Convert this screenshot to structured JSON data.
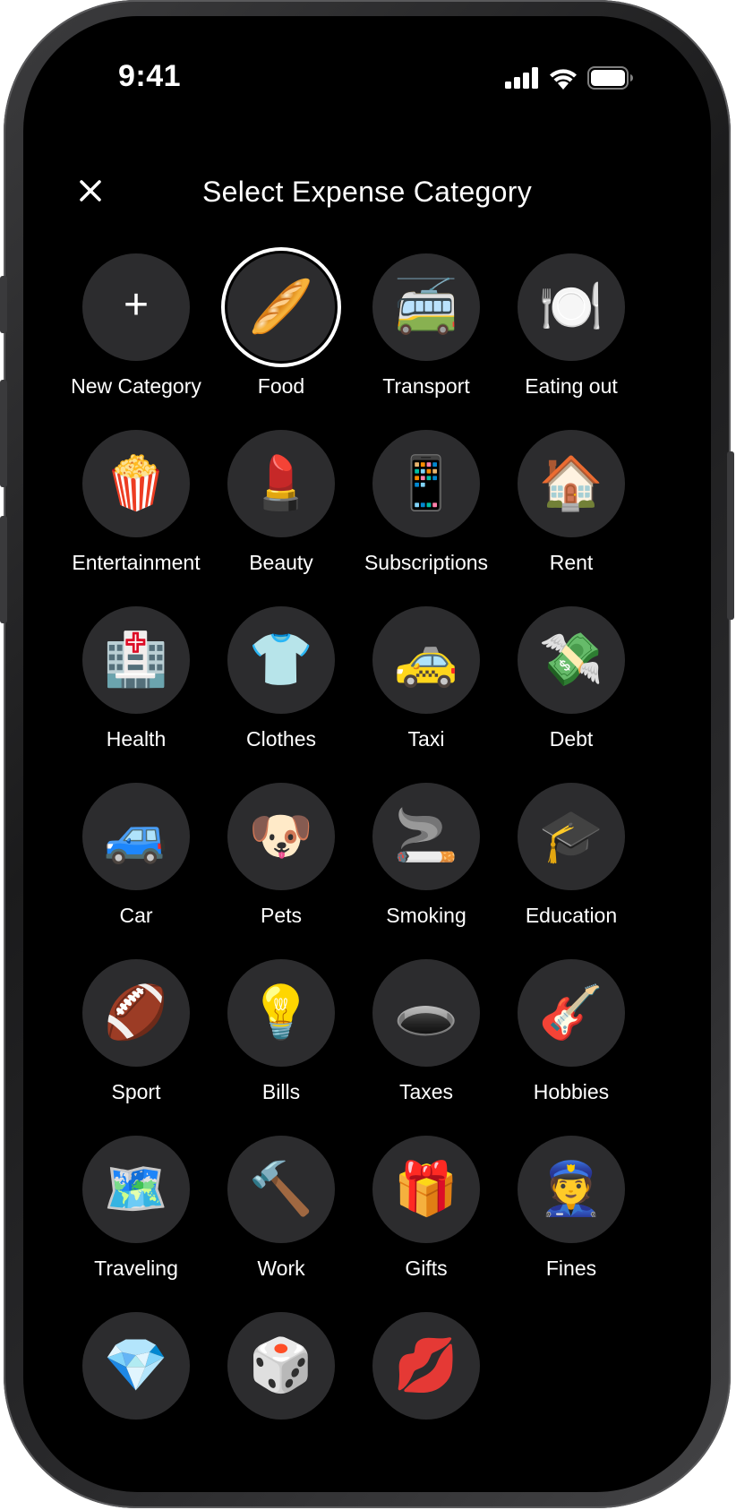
{
  "status_bar": {
    "time": "9:41"
  },
  "header": {
    "title": "Select Expense Category",
    "close_icon": "close-icon"
  },
  "categories": [
    {
      "label": "New Category",
      "icon": "+",
      "icon_name": "plus-icon"
    },
    {
      "label": "Food",
      "icon": "🥖",
      "icon_name": "baguette-icon",
      "selected": true
    },
    {
      "label": "Transport",
      "icon": "🚎",
      "icon_name": "trolleybus-icon"
    },
    {
      "label": "Eating out",
      "icon": "🍽️",
      "icon_name": "plate-cutlery-icon"
    },
    {
      "label": "Entertainment",
      "icon": "🍿",
      "icon_name": "popcorn-icon"
    },
    {
      "label": "Beauty",
      "icon": "💄",
      "icon_name": "lipstick-icon"
    },
    {
      "label": "Subscriptions",
      "icon": "📱",
      "icon_name": "phone-icon"
    },
    {
      "label": "Rent",
      "icon": "🏠",
      "icon_name": "house-icon"
    },
    {
      "label": "Health",
      "icon": "🏥",
      "icon_name": "hospital-icon"
    },
    {
      "label": "Clothes",
      "icon": "👕",
      "icon_name": "shirt-icon"
    },
    {
      "label": "Taxi",
      "icon": "🚕",
      "icon_name": "taxi-icon"
    },
    {
      "label": "Debt",
      "icon": "💸",
      "icon_name": "money-wings-icon"
    },
    {
      "label": "Car",
      "icon": "🚙",
      "icon_name": "car-icon"
    },
    {
      "label": "Pets",
      "icon": "🐶",
      "icon_name": "dog-icon"
    },
    {
      "label": "Smoking",
      "icon": "🚬",
      "icon_name": "cigarette-icon"
    },
    {
      "label": "Education",
      "icon": "🎓",
      "icon_name": "graduation-cap-icon"
    },
    {
      "label": "Sport",
      "icon": "🏈",
      "icon_name": "football-icon"
    },
    {
      "label": "Bills",
      "icon": "💡",
      "icon_name": "light-bulb-icon"
    },
    {
      "label": "Taxes",
      "icon": "🕳️",
      "icon_name": "hole-icon"
    },
    {
      "label": "Hobbies",
      "icon": "🎸",
      "icon_name": "guitar-icon"
    },
    {
      "label": "Traveling",
      "icon": "🗺️",
      "icon_name": "map-icon"
    },
    {
      "label": "Work",
      "icon": "🔨",
      "icon_name": "hammer-icon"
    },
    {
      "label": "Gifts",
      "icon": "🎁",
      "icon_name": "gift-icon"
    },
    {
      "label": "Fines",
      "icon": "👮",
      "icon_name": "police-officer-icon"
    },
    {
      "label": "",
      "icon": "💎",
      "icon_name": "gem-icon"
    },
    {
      "label": "",
      "icon": "🎲",
      "icon_name": "dice-icon"
    },
    {
      "label": "",
      "icon": "💋",
      "icon_name": "kiss-mark-icon"
    }
  ],
  "colors": {
    "background": "#000000",
    "circle": "#2c2c2e",
    "text": "#ffffff",
    "selected_ring": "#ffffff"
  }
}
